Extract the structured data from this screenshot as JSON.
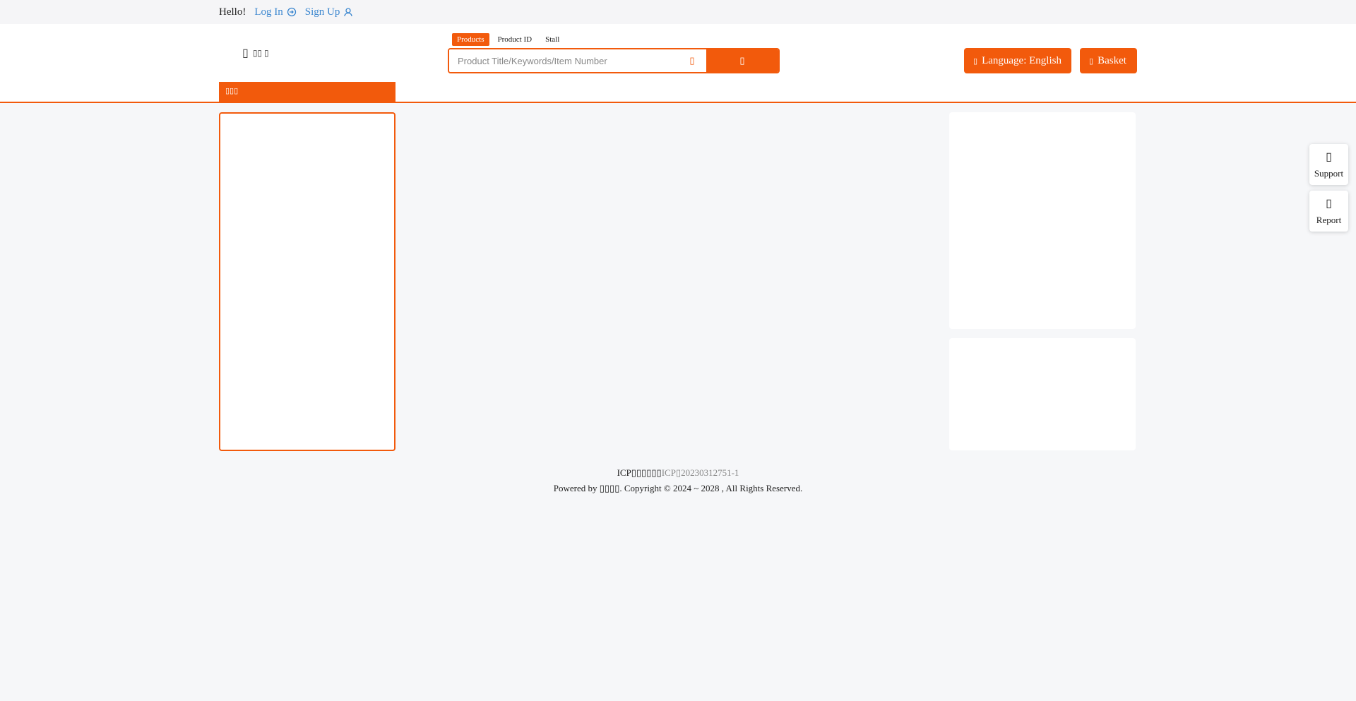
{
  "topbar": {
    "greeting": "Hello!",
    "login": "Log In",
    "signup": "Sign Up"
  },
  "logo": {
    "text": "▯▯ ▯"
  },
  "search": {
    "tabs": [
      "Products",
      "Product ID",
      "Stall"
    ],
    "active_tab": "Products",
    "placeholder": "Product Title/Keywords/Item Number",
    "image_search_icon": "camera-icon",
    "search_button_icon": "search-icon"
  },
  "actions": {
    "language": "Language: English",
    "basket": "Basket"
  },
  "category": {
    "header": "▯▯▯"
  },
  "footer": {
    "icp_label": "ICP▯▯▯▯▯▯",
    "icp_number": "ICP▯20230312751-1",
    "copyright": "Powered by ▯▯▯▯. Copyright © 2024 ~ 2028 , All Rights Reserved."
  },
  "float": {
    "support": "Support",
    "report": "Report"
  },
  "colors": {
    "accent": "#f25a0c",
    "link": "#3a86cf",
    "background": "#f6f7f9"
  }
}
